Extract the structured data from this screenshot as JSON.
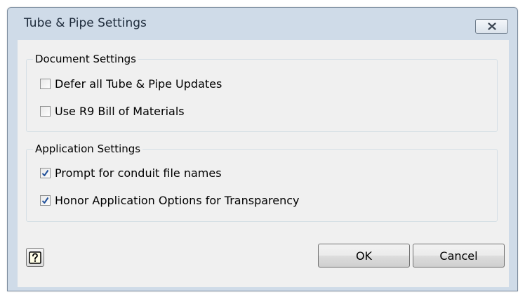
{
  "window": {
    "title": "Tube & Pipe Settings"
  },
  "document_settings": {
    "legend": "Document Settings",
    "options": [
      {
        "label": "Defer all Tube & Pipe Updates",
        "checked": false
      },
      {
        "label": "Use R9 Bill of Materials",
        "checked": false
      }
    ]
  },
  "application_settings": {
    "legend": "Application Settings",
    "options": [
      {
        "label": "Prompt for conduit file names",
        "checked": true
      },
      {
        "label": "Honor Application Options for Transparency",
        "checked": true
      }
    ]
  },
  "buttons": {
    "ok_label": "OK",
    "cancel_label": "Cancel"
  },
  "colors": {
    "frame": "#cfdbe8",
    "client": "#f0f0f0",
    "check_mark": "#1f4f99"
  }
}
